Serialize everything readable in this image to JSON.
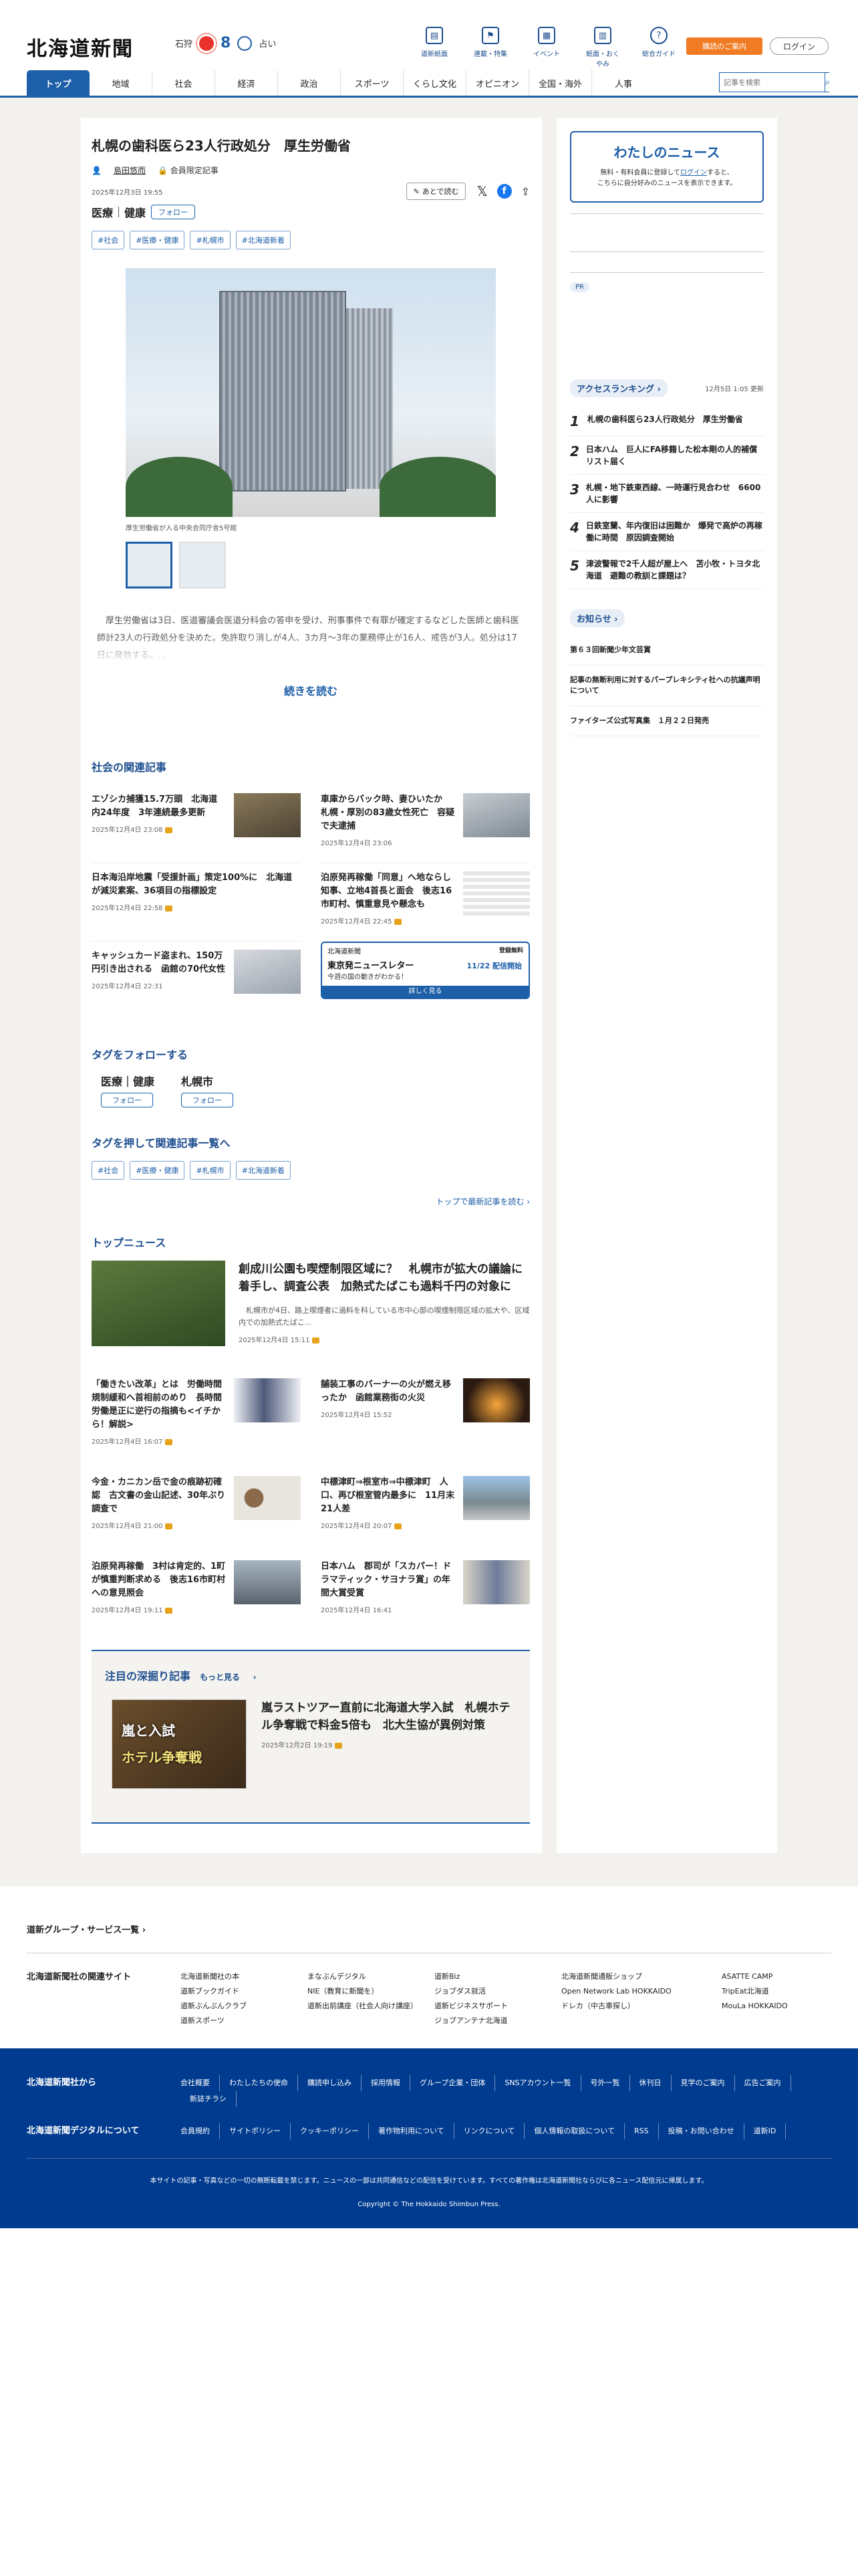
{
  "header": {
    "logo": "北海道新聞",
    "weather": {
      "city": "石狩",
      "hi": "8",
      "temp_label": "℃",
      "fortune_label": "占い"
    },
    "icons": [
      {
        "label": "道新紙面",
        "icon": "newspaper-icon"
      },
      {
        "label": "連載・特集",
        "icon": "flag-icon"
      },
      {
        "label": "イベント",
        "icon": "calendar-icon"
      },
      {
        "label": "紙面・おくやみ",
        "icon": "paper-icon"
      },
      {
        "label": "総合ガイド",
        "icon": "help-icon"
      }
    ],
    "subscribe": "購読のご案内",
    "login": "ログイン"
  },
  "nav": {
    "items": [
      "トップ",
      "地域",
      "社会",
      "経済",
      "政治",
      "スポーツ",
      "くらし文化",
      "オピニオン",
      "全国・海外",
      "人事"
    ],
    "search_placeholder": "記事を検索"
  },
  "article": {
    "title": "札幌の歯科医ら23人行政処分　厚生労働省",
    "author": "島田悠而",
    "author_sub": "会員限定記事",
    "date": "2025年12月3日 19:55",
    "later": "あとで読む",
    "categories": [
      "医療",
      "健康"
    ],
    "follow": "フォロー",
    "tags": [
      "#社会",
      "#医療・健康",
      "#札幌市",
      "#北海道新着"
    ],
    "caption": "厚生労働省が入る中央合同庁舎5号館",
    "body": "　厚生労働省は3日、医道審議会医道分科会の答申を受け、刑事事件で有罪が確定するなどした医師と歯科医師計23人の行政処分を決めた。免許取り消しが4人、3カ月〜3年の業務停止が16人、戒告が3人。処分は17日に発効する。...",
    "read_more": "続きを読む"
  },
  "related": {
    "title": "社会の関連記事",
    "items": [
      {
        "title": "エゾシカ捕獲15.7万頭　北海道内24年度　3年連続最多更新",
        "date": "2025年12月4日 23:08"
      },
      {
        "title": "車庫からバック時、妻ひいたか　札幌・厚別の83歳女性死亡　容疑で夫逮捕",
        "date": "2025年12月4日 23:06"
      },
      {
        "title": "日本海沿岸地震「受援計画」策定100%に　北海道が減災素案、36項目の指標設定",
        "date": "2025年12月4日 22:58"
      },
      {
        "title": "泊原発再稼働「同意」へ地ならし　知事、立地4首長と面会　後志16市町村、慎重意見や懸念も",
        "date": "2025年12月4日 22:45"
      },
      {
        "title": "キャッシュカード盗まれ、150万円引き出される　函館の70代女性",
        "date": "2025年12月4日 22:31"
      }
    ],
    "ad": {
      "brand": "北海道新聞",
      "reg": "登録無料",
      "name": "東京発ニュースレター",
      "start": "11/22 配信開始",
      "sub": "今週の国の動きがわかる！",
      "cta": "詳しく見る"
    }
  },
  "follow_tags": {
    "title": "タグをフォローする",
    "items": [
      {
        "name": "医療｜健康",
        "btn": "フォロー"
      },
      {
        "name": "札幌市",
        "btn": "フォロー"
      }
    ]
  },
  "push_tags": {
    "title": "タグを押して関連記事一覧へ",
    "items": [
      "#社会",
      "#医療・健康",
      "#札幌市",
      "#北海道新着"
    ]
  },
  "to_top": "トップで最新記事を読む",
  "top_news": {
    "title": "トップニュース",
    "lead": {
      "title": "創成川公園も喫煙制限区域に？　札幌市が拡大の議論に着手し、調査公表　加熱式たばこも過料千円の対象に",
      "body": "　札幌市が4日、路上喫煙者に過料を科している市中心部の喫煙制限区域の拡大や、区域内での加熱式たばこ...",
      "date": "2025年12月4日 15:11"
    },
    "items": [
      {
        "title": "「働きたい改革」とは　労働時間規制緩和へ首相前のめり　長時間労働是正に逆行の指摘も<イチから！解説>",
        "date": "2025年12月4日 16:07"
      },
      {
        "title": "舗装工事のバーナーの火が燃え移ったか　函館業務街の火災",
        "date": "2025年12月4日 15:52"
      },
      {
        "title": "今金・カニカン岳で金の痕跡初確認　古文書の金山記述、30年ぶり調査で",
        "date": "2025年12月4日 21:00"
      },
      {
        "title": "中標津町⇒根室市⇒中標津町　人口、再び根室管内最多に　11月末21人差",
        "date": "2025年12月4日 20:07"
      },
      {
        "title": "泊原発再稼働　3村は肯定的、1町が慎重判断求める　後志16市町村への意見照会",
        "date": "2025年12月4日 19:11"
      },
      {
        "title": "日本ハム　郡司が「スカパー！ドラマティック・サヨナラ賞」の年間大賞受賞",
        "date": "2025年12月4日 16:41"
      }
    ]
  },
  "deep": {
    "title": "注目の深掘り記事",
    "more": "もっと見る",
    "img_t1": "嵐と入試",
    "img_t2": "ホテル争奪戦",
    "article": "嵐ラストツアー直前に北海道大学入試　札幌ホテル争奪戦で料金5倍も　北大生協が異例対策",
    "date": "2025年12月2日 19:19"
  },
  "side": {
    "my_news": {
      "title": "わたしのニュース",
      "p1": "無料・有料会員に登録して",
      "login": "ログイン",
      "p2": "すると、",
      "p3": "こちらに自分好みのニュースを表示できます。"
    },
    "pr": "PR",
    "ranking": {
      "title": "アクセスランキング",
      "updated": "12月5日 1:05 更新",
      "items": [
        "札幌の歯科医ら23人行政処分　厚生労働省",
        "日本ハム　巨人にFA移籍した松本剛の人的補償リスト届く",
        "札幌・地下鉄東西線、一時運行見合わせ　6600人に影響",
        "日鉄室蘭、年内復旧は困難か　爆発で高炉の再稼働に時間　原因調査開始",
        "津波警報で2千人超が屋上へ　苫小牧・トヨタ北海道　避難の教訓と課題は？"
      ]
    },
    "notice": {
      "title": "お知らせ",
      "items": [
        "第６３回新聞少年文芸賞",
        "記事の無断利用に対するパープレキシティ社への抗議声明について",
        "ファイターズ公式写真集　１月２２日発売"
      ]
    }
  },
  "group": {
    "title": "道新グループ・サービス一覧",
    "label": "北海道新聞社の関連サイト",
    "cols": [
      [
        "北海道新聞社の本",
        "道新ブックガイド",
        "道新ぶんぶんクラブ",
        "道新スポーツ"
      ],
      [
        "まなぶんデジタル",
        "NIE（教育に新聞を）",
        "道新出前講座（社会人向け講座）"
      ],
      [
        "道新Biz",
        "ジョブダス就活",
        "道新ビジネスサポート",
        "ジョブアンテナ北海道"
      ],
      [
        "北海道新聞通販ショップ",
        "Open Network Lab HOKKAIDO",
        "ドレカ（中古車探し）"
      ],
      [
        "ASATTE CAMP",
        "TripEat北海道",
        "MouLa HOKKAIDO"
      ]
    ]
  },
  "footer": {
    "row1_label": "北海道新聞社から",
    "row1": [
      "会社概要",
      "わたしたちの使命",
      "購読申し込み",
      "採用情報",
      "グループ企業・団体",
      "SNSアカウント一覧",
      "号外一覧",
      "休刊日",
      "見学のご案内",
      "広告ご案内",
      "新誌チラシ"
    ],
    "row2_label": "北海道新聞デジタルについて",
    "row2": [
      "会員規約",
      "サイトポリシー",
      "クッキーポリシー",
      "著作物利用について",
      "リンクについて",
      "個人情報の取扱について",
      "RSS",
      "投稿・お問い合わせ",
      "道新ID"
    ],
    "note": "本サイトの記事・写真などの一切の無断転載を禁じます。ニュースの一部は共同通信などの配信を受けています。すべての著作権は北海道新聞社ならびに各ニュース配信元に帰属します。",
    "copyright": "Copyright © The Hokkaido Shimbun Press."
  }
}
